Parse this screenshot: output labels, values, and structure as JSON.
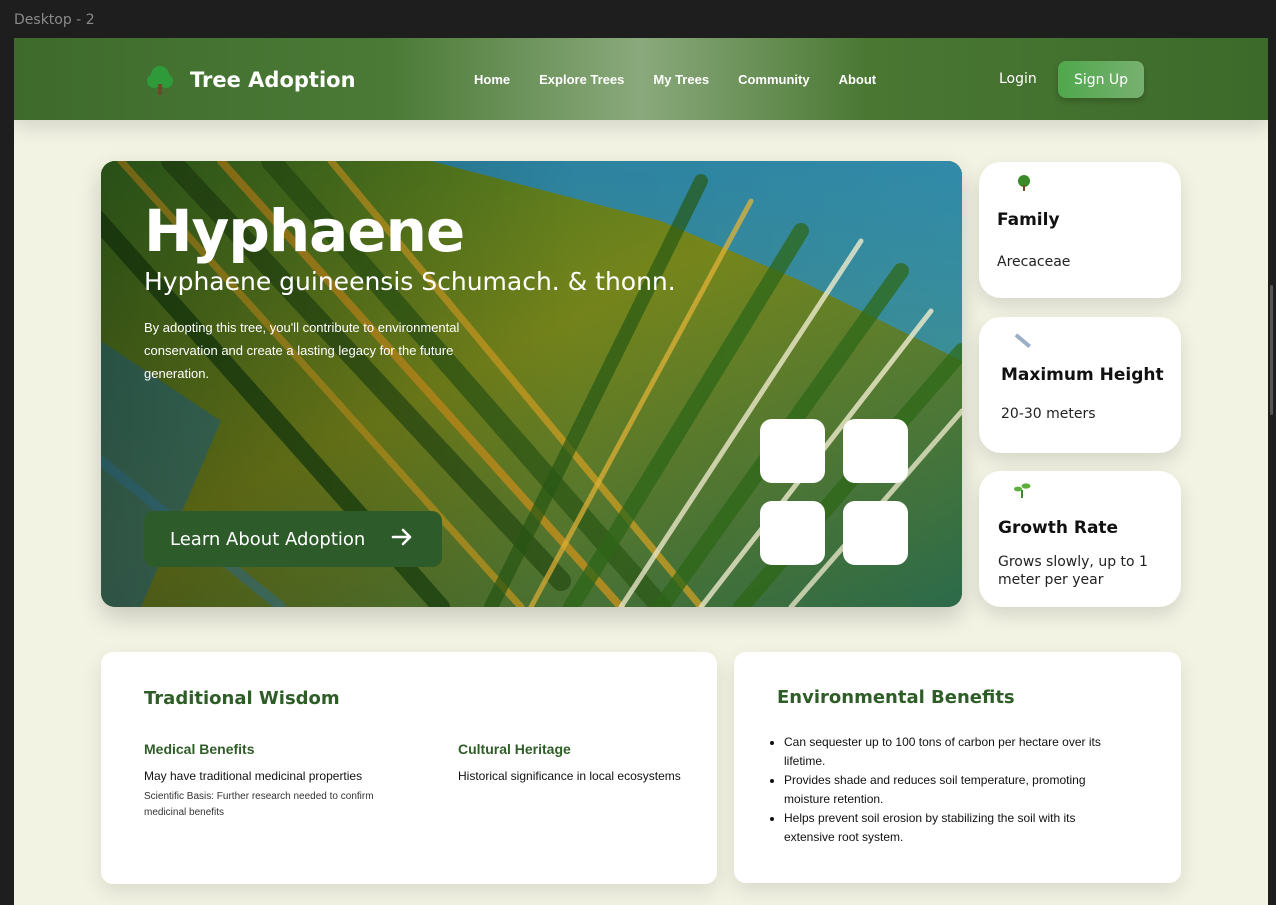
{
  "frame_label": "Desktop - 2",
  "header": {
    "brand": "Tree Adoption",
    "nav": [
      "Home",
      "Explore Trees",
      "My Trees",
      "Community",
      "About"
    ],
    "login": "Login",
    "signup": "Sign Up"
  },
  "hero": {
    "title": "Hyphaene",
    "scientific_name": "Hyphaene guineensis Schumach. & thonn.",
    "description": "By adopting this tree, you'll contribute to environmental conservation and create a lasting legacy for the future generation.",
    "cta": "Learn About Adoption"
  },
  "info_cards": [
    {
      "icon": "tree-icon",
      "title": "Family",
      "value": "Arecaceae"
    },
    {
      "icon": "ruler-icon",
      "title": "Maximum Height",
      "value": "20-30 meters"
    },
    {
      "icon": "seedling-icon",
      "title": "Growth Rate",
      "value": "Grows slowly, up to 1 meter per year"
    }
  ],
  "wisdom": {
    "title": "Traditional Wisdom",
    "medical": {
      "heading": "Medical Benefits",
      "text": "May have traditional medicinal properties",
      "note": "Scientific Basis: Further research needed to confirm medicinal benefits"
    },
    "cultural": {
      "heading": "Cultural Heritage",
      "text": "Historical significance in local ecosystems"
    }
  },
  "environment": {
    "title": "Environmental Benefits",
    "items": [
      "Can sequester up to 100 tons of carbon per hectare over its lifetime.",
      "Provides shade and reduces soil temperature, promoting moisture retention.",
      "Helps prevent soil erosion by stabilizing the soil with its extensive root system."
    ]
  },
  "colors": {
    "header_green": "#3e6b2c",
    "accent_green": "#4fa84c",
    "heading_green": "#2f5d28",
    "page_bg": "#f3f3e4"
  }
}
